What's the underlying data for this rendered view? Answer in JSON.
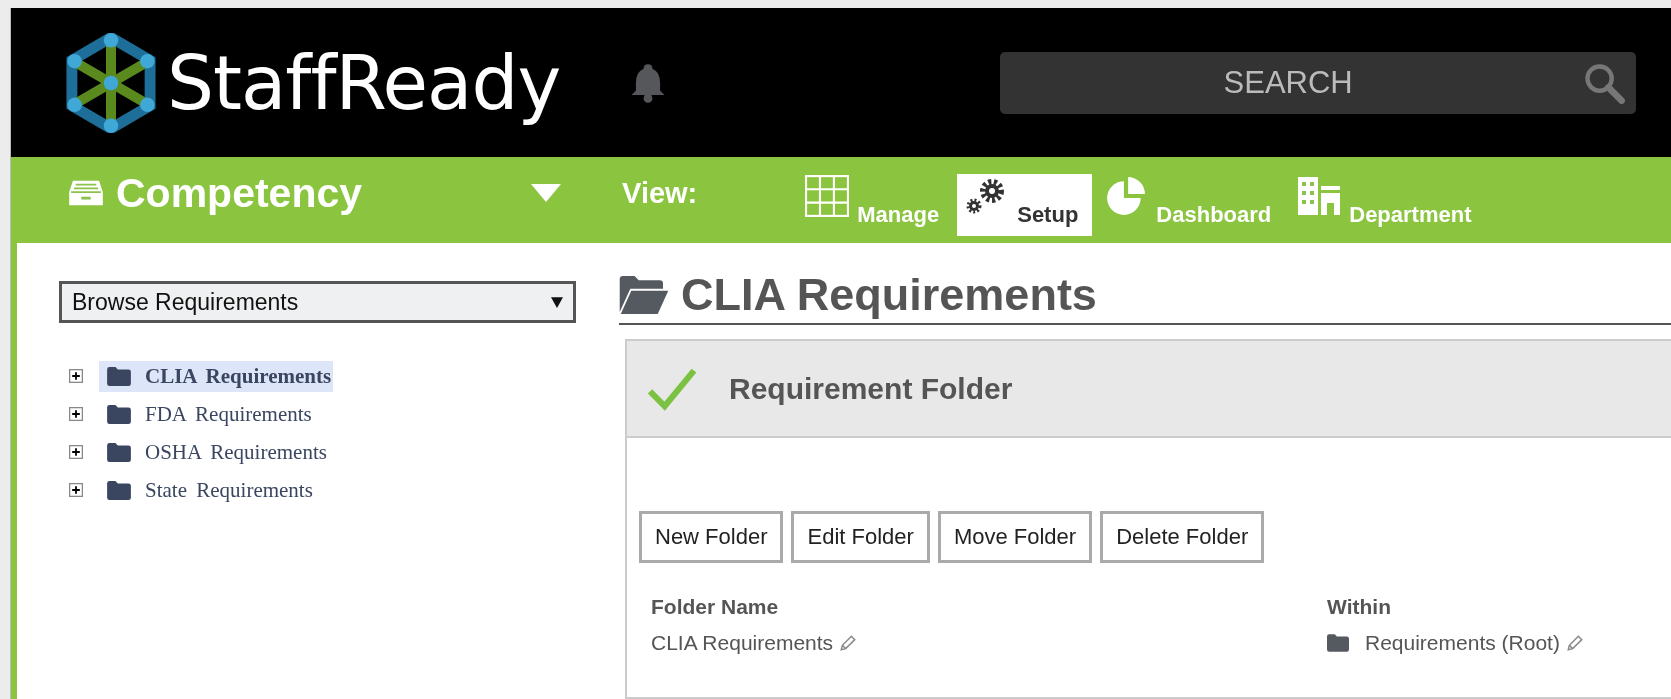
{
  "header": {
    "logo_text": "StaffReady",
    "search": {
      "placeholder": "SEARCH"
    }
  },
  "nav": {
    "module": "Competency",
    "view_label": "View:",
    "tabs": [
      {
        "label": "Manage",
        "kind": "grid",
        "selected": false
      },
      {
        "label": "Setup",
        "kind": "gears",
        "selected": true
      },
      {
        "label": "Dashboard",
        "kind": "pie",
        "selected": false
      },
      {
        "label": "Department",
        "kind": "building",
        "selected": false
      }
    ]
  },
  "sidebar": {
    "dropdown": {
      "value": "Browse Requirements"
    },
    "tree": [
      {
        "label": "CLIA Requirements",
        "expanded": false,
        "selected": true
      },
      {
        "label": "FDA Requirements",
        "expanded": false,
        "selected": false
      },
      {
        "label": "OSHA Requirements",
        "expanded": false,
        "selected": false
      },
      {
        "label": "State Requirements",
        "expanded": false,
        "selected": false
      }
    ]
  },
  "main": {
    "title": "CLIA Requirements",
    "panel": {
      "title": "Requirement Folder",
      "buttons": [
        "New Folder",
        "Edit Folder",
        "Move Folder",
        "Delete Folder"
      ],
      "fields": [
        {
          "label": "Folder Name",
          "value": "CLIA Requirements",
          "kind": "text"
        },
        {
          "label": "Within",
          "value": "Requirements (Root)",
          "kind": "folder"
        }
      ]
    }
  }
}
